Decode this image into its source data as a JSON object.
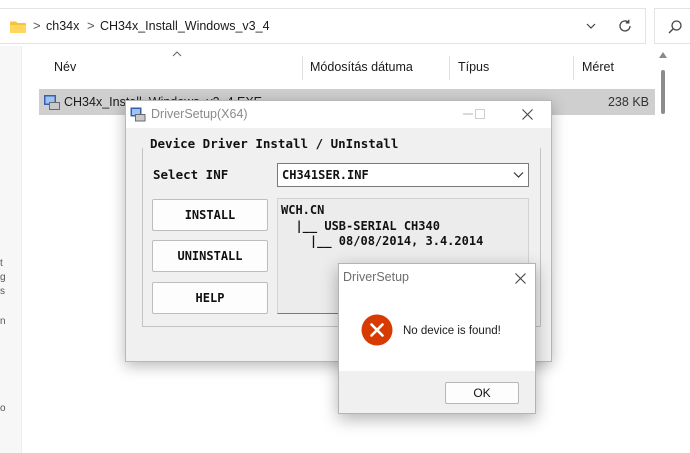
{
  "explorer": {
    "breadcrumb": [
      "ch34x",
      "CH34x_Install_Windows_v3_4"
    ],
    "breadcrumb_separator": ">",
    "columns": {
      "name": "Név",
      "modified": "Módosítás dátuma",
      "type": "Típus",
      "size": "Méret"
    },
    "file": {
      "name": "CH34x_Install_Windows_v3_4.EXE",
      "size": "238 KB"
    },
    "left_glyphs": [
      "t",
      "g",
      "s",
      "n",
      "o"
    ]
  },
  "driver_setup": {
    "title": "DriverSetup(X64)",
    "heading": "Device Driver Install / UnInstall",
    "select_label": "Select INF",
    "selected_inf": "CH341SER.INF",
    "buttons": {
      "install": "INSTALL",
      "uninstall": "UNINSTALL",
      "help": "HELP"
    },
    "info_lines": [
      "WCH.CN",
      "  |__ USB-SERIAL CH340",
      "    |__ 08/08/2014, 3.4.2014"
    ]
  },
  "error_dialog": {
    "title": "DriverSetup",
    "message": "No device is found!",
    "ok_label": "OK"
  },
  "colors": {
    "error_red": "#D83B01",
    "selection_gray": "#cfcfcf",
    "dialog_bg": "#f0f0f0"
  }
}
